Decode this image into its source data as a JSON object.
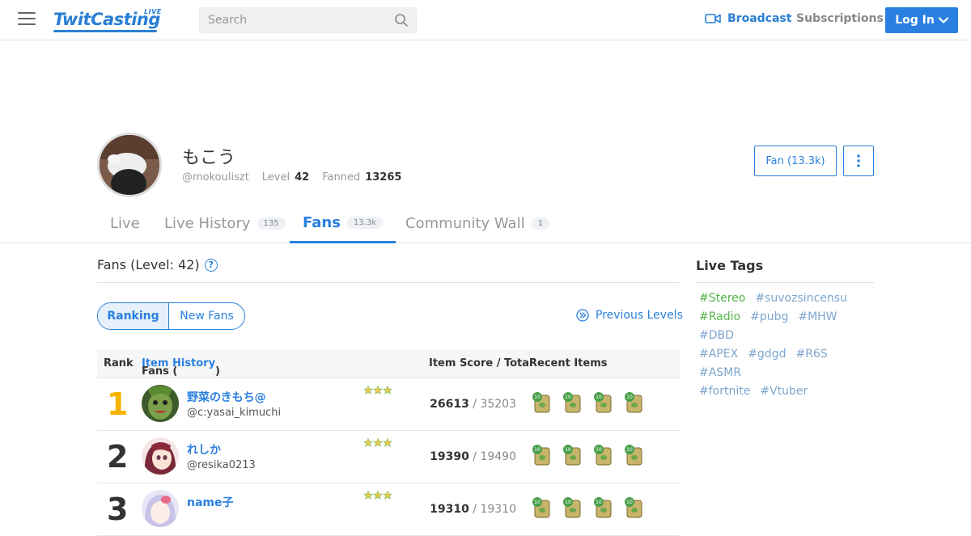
{
  "header": {
    "logo_text": "TwitCasting",
    "logo_badge": "LIVE",
    "search_placeholder": "Search",
    "broadcast_label": "Broadcast",
    "subscriptions_label": "Subscriptions",
    "login_label": "Log In"
  },
  "profile": {
    "name": "もこう",
    "handle": "@mokouliszt",
    "level_label": "Level",
    "level_value": "42",
    "fanned_label": "Fanned",
    "fanned_value": "13265",
    "fan_button_label": "Fan (13.3k)"
  },
  "tabs": [
    {
      "label": "Live",
      "badge": ""
    },
    {
      "label": "Live History",
      "badge": "135"
    },
    {
      "label": "Fans",
      "badge": "13.3k",
      "active": true
    },
    {
      "label": "Community Wall",
      "badge": "1"
    }
  ],
  "fans": {
    "title": "Fans (Level: 42)",
    "help_glyph": "?",
    "segment_ranking": "Ranking",
    "segment_new": "New Fans",
    "previous_levels_label": "Previous Levels",
    "columns": {
      "rank": "Rank",
      "fans_prefix": "Fans (",
      "item_history_link": "Item History",
      "fans_suffix": ")",
      "score": "Item Score / Total",
      "recent": "Recent Items"
    },
    "rows": [
      {
        "rank": "1",
        "name": "野菜のきもち@",
        "id": "@c:yasai_kimuchi",
        "score": "26613",
        "total": "/ 35203"
      },
      {
        "rank": "2",
        "name": "れしか",
        "id": "@resika0213",
        "score": "19390",
        "total": "/ 19490"
      },
      {
        "rank": "3",
        "name": "name子",
        "id": "",
        "score": "19310",
        "total": "/ 19310"
      }
    ]
  },
  "sidebar": {
    "title": "Live Tags",
    "tags": [
      {
        "label": "#Stereo",
        "color": "#55b549"
      },
      {
        "label": "#suvozsincensu",
        "color": "#7da6cf"
      },
      {
        "label": "#Radio",
        "color": "#55b549"
      },
      {
        "label": "#pubg",
        "color": "#7da6cf"
      },
      {
        "label": "#MHW",
        "color": "#7da6cf"
      },
      {
        "label": "#DBD",
        "color": "#7da6cf"
      },
      {
        "label": "#APEX",
        "color": "#7da6cf"
      },
      {
        "label": "#gdgd",
        "color": "#7da6cf"
      },
      {
        "label": "#R6S",
        "color": "#7da6cf"
      },
      {
        "label": "#ASMR",
        "color": "#7da6cf"
      },
      {
        "label": "#fortnite",
        "color": "#7da6cf"
      },
      {
        "label": "#Vtuber",
        "color": "#7da6cf"
      }
    ]
  },
  "colors": {
    "accent": "#2a80e0",
    "gold": "#f4b400",
    "tag_green": "#55b549",
    "tag_blue": "#7da6cf"
  }
}
